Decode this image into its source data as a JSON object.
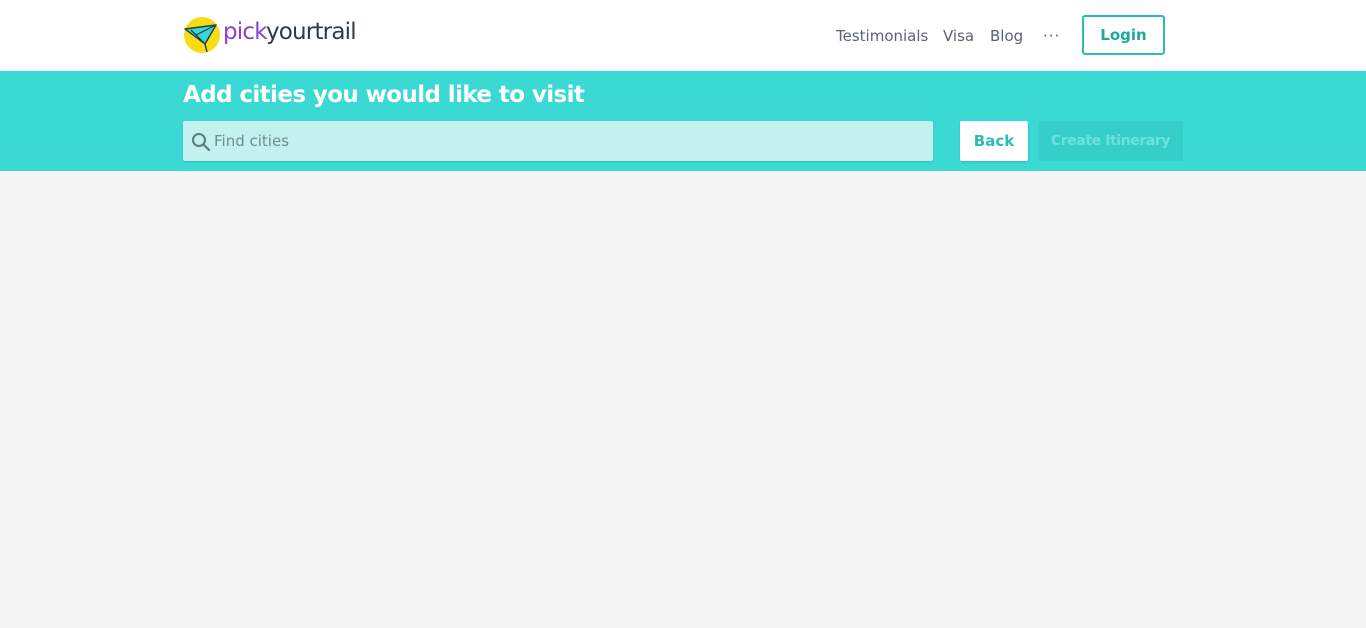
{
  "brand": {
    "name_part1": "pick",
    "name_part2": "yourtrail",
    "colors": {
      "pick": "#8b3fd6",
      "yourtrail": "#2f3b4b",
      "logo_circle": "#f7dc12",
      "logo_plane": "#3ad9d3"
    }
  },
  "nav": {
    "items": [
      {
        "label": "Testimonials"
      },
      {
        "label": "Visa"
      },
      {
        "label": "Blog"
      }
    ],
    "more_label": "···",
    "login_label": "Login"
  },
  "banner": {
    "title": "Add cities you would like to visit",
    "background": "#3ad9d3"
  },
  "search": {
    "placeholder": "Find cities",
    "value": "",
    "icon": "search-icon"
  },
  "actions": {
    "back_label": "Back",
    "create_label": "Create Itinerary"
  }
}
